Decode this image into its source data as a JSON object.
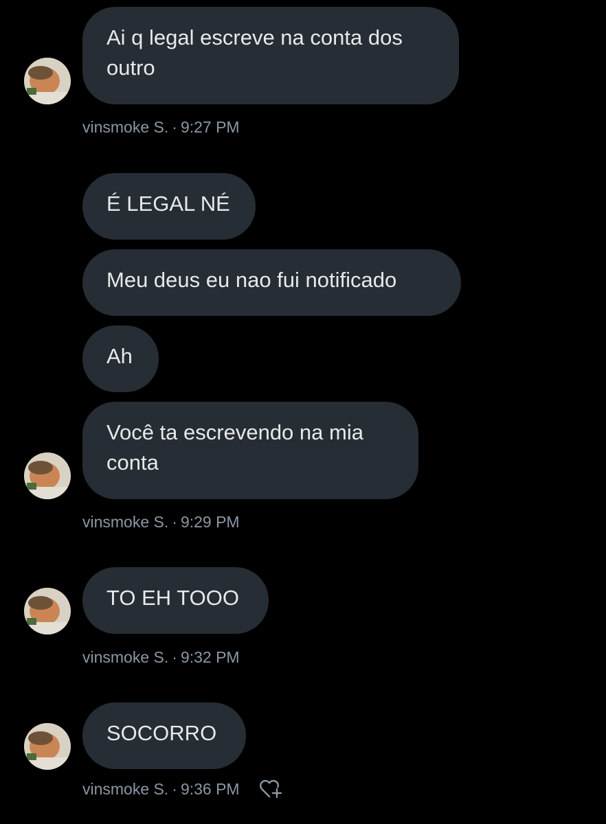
{
  "colors": {
    "background": "#000000",
    "bubble": "#262d34",
    "text": "#e7e9ea",
    "meta": "#8b98a5"
  },
  "messages": [
    {
      "text": "Ai q legal escreve na conta dos\noutro"
    },
    {
      "text": "É LEGAL NÉ"
    },
    {
      "text": "Meu deus eu nao fui notificado"
    },
    {
      "text": "Ah"
    },
    {
      "text": "Você ta escrevendo na mia\nconta"
    },
    {
      "text": "TO EH TOOO"
    },
    {
      "text": "SOCORRO"
    }
  ],
  "meta": [
    {
      "sender": "vinsmoke S.",
      "separator": "·",
      "time": "9:27 PM"
    },
    {
      "sender": "vinsmoke S.",
      "separator": "·",
      "time": "9:29 PM"
    },
    {
      "sender": "vinsmoke S.",
      "separator": "·",
      "time": "9:32 PM"
    },
    {
      "sender": "vinsmoke S.",
      "separator": "·",
      "time": "9:36 PM"
    }
  ],
  "icons": {
    "avatar": "avatar",
    "react": "heart-plus-icon"
  }
}
